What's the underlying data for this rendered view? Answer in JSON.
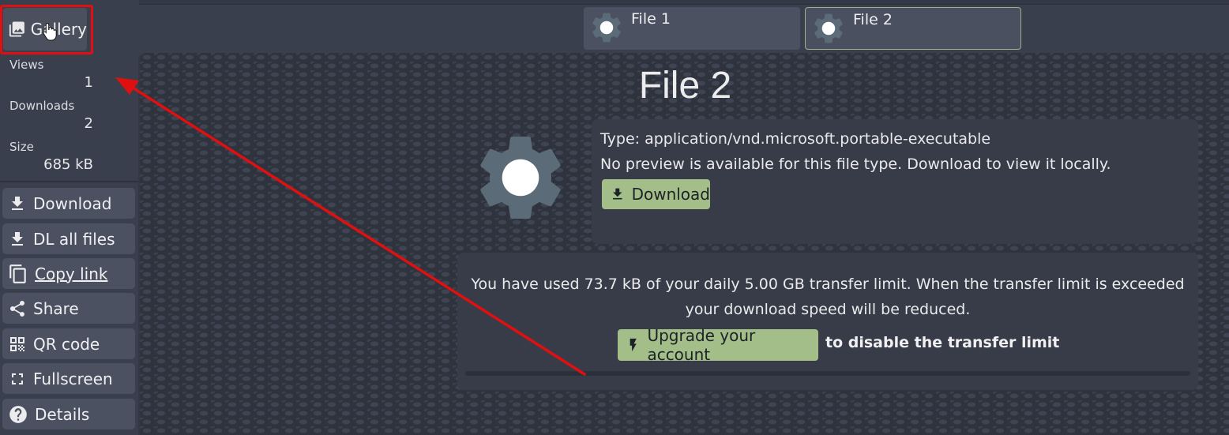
{
  "sidebar": {
    "gallery_label": "Gallery",
    "stats": [
      {
        "label": "Views",
        "value": "1"
      },
      {
        "label": "Downloads",
        "value": "2"
      },
      {
        "label": "Size",
        "value": "685 kB"
      }
    ],
    "buttons": [
      {
        "label": "Download",
        "icon": "download-icon"
      },
      {
        "label": "DL all files",
        "icon": "download-icon"
      },
      {
        "label": "Copy link",
        "icon": "copy-icon"
      },
      {
        "label": "Share",
        "icon": "share-icon"
      },
      {
        "label": "QR code",
        "icon": "qr-code-icon"
      },
      {
        "label": "Fullscreen",
        "icon": "fullscreen-icon"
      },
      {
        "label": "Details",
        "icon": "help-circle-icon"
      }
    ]
  },
  "tabs": [
    {
      "label": "File 1",
      "active": false
    },
    {
      "label": "File 2",
      "active": true
    }
  ],
  "main": {
    "title": "File 2",
    "type_line": "Type: application/vnd.microsoft.portable-executable",
    "preview_line": "No preview is available for this file type. Download to view it locally.",
    "download_label": "Download",
    "limit_text": "You have used 73.7 kB of your daily 5.00 GB transfer limit. When the transfer limit is exceeded your download speed will be reduced.",
    "upgrade_label": "Upgrade your account",
    "upgrade_suffix": "to disable the transfer limit",
    "transfer_used_fraction": 0.0
  },
  "colors": {
    "accent_green": "#a3be88",
    "highlight_red": "#e01010",
    "panel_bg": "#383c48",
    "button_bg": "#4b5161"
  }
}
